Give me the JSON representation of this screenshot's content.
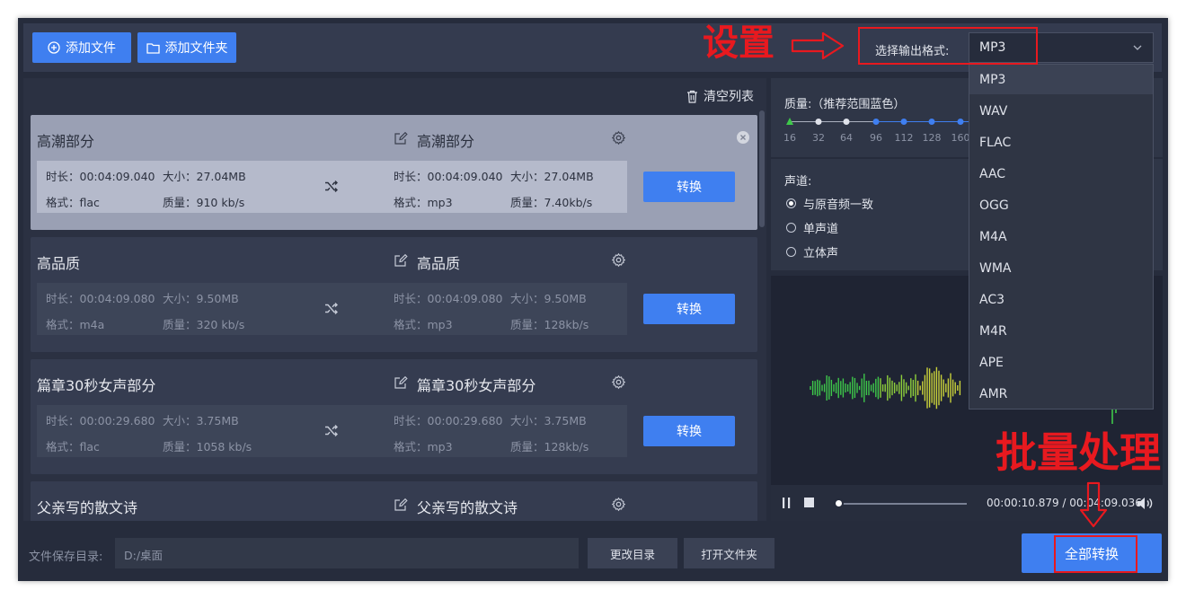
{
  "toolbar": {
    "add_file": "添加文件",
    "add_folder": "添加文件夹"
  },
  "list": {
    "clear_label": "清空列表",
    "items": [
      {
        "name": "高潮部分",
        "out_name": "高潮部分",
        "src_duration": "时长：00:04:09.040",
        "src_size": "大小：27.04MB",
        "src_format": "格式：flac",
        "src_quality": "质量：910 kb/s",
        "out_duration": "时长：00:04:09.040",
        "out_size": "大小：27.04MB",
        "out_format": "格式：mp3",
        "out_quality": "质量：7.40kb/s",
        "convert": "转换"
      },
      {
        "name": "高品质",
        "out_name": "高品质",
        "src_duration": "时长：00:04:09.080",
        "src_size": "大小：9.50MB",
        "src_format": "格式：m4a",
        "src_quality": "质量：320 kb/s",
        "out_duration": "时长：00:04:09.080",
        "out_size": "大小：9.50MB",
        "out_format": "格式：mp3",
        "out_quality": "质量：128kb/s",
        "convert": "转换"
      },
      {
        "name": "篇章30秒女声部分",
        "out_name": "篇章30秒女声部分",
        "src_duration": "时长：00:00:29.680",
        "src_size": "大小：3.75MB",
        "src_format": "格式：flac",
        "src_quality": "质量：1058 kb/s",
        "out_duration": "时长：00:00:29.680",
        "out_size": "大小：3.75MB",
        "out_format": "格式：mp3",
        "out_quality": "质量：128kb/s",
        "convert": "转换"
      },
      {
        "name": "父亲写的散文诗",
        "out_name": "父亲写的散文诗"
      }
    ]
  },
  "format": {
    "label": "选择输出格式:",
    "selected": "MP3",
    "options": [
      "MP3",
      "WAV",
      "FLAC",
      "AAC",
      "OGG",
      "M4A",
      "WMA",
      "AC3",
      "M4R",
      "APE",
      "AMR"
    ]
  },
  "quality": {
    "label": "质量:（推荐范围蓝色）",
    "ticks": [
      "16",
      "32",
      "64",
      "96",
      "112",
      "128",
      "160"
    ]
  },
  "channel": {
    "label": "声道:",
    "options": [
      "与原音频一致",
      "单声道",
      "立体声"
    ],
    "selected_index": 0
  },
  "player": {
    "time": "00:00:10.879 / 00:04:09.036",
    "progress": 0.02
  },
  "bottom": {
    "save_label": "文件保存目录:",
    "save_path": "D:/桌面",
    "change_dir": "更改目录",
    "open_folder": "打开文件夹",
    "convert_all": "全部转换"
  },
  "annotations": {
    "settings": "设置",
    "batch": "批量处理"
  },
  "colors": {
    "accent": "#3f7ff0",
    "annotation": "#e8191f",
    "background": "#262c3c",
    "waveform_green": "#3ec84a",
    "waveform_yellow": "#c9d23a"
  }
}
